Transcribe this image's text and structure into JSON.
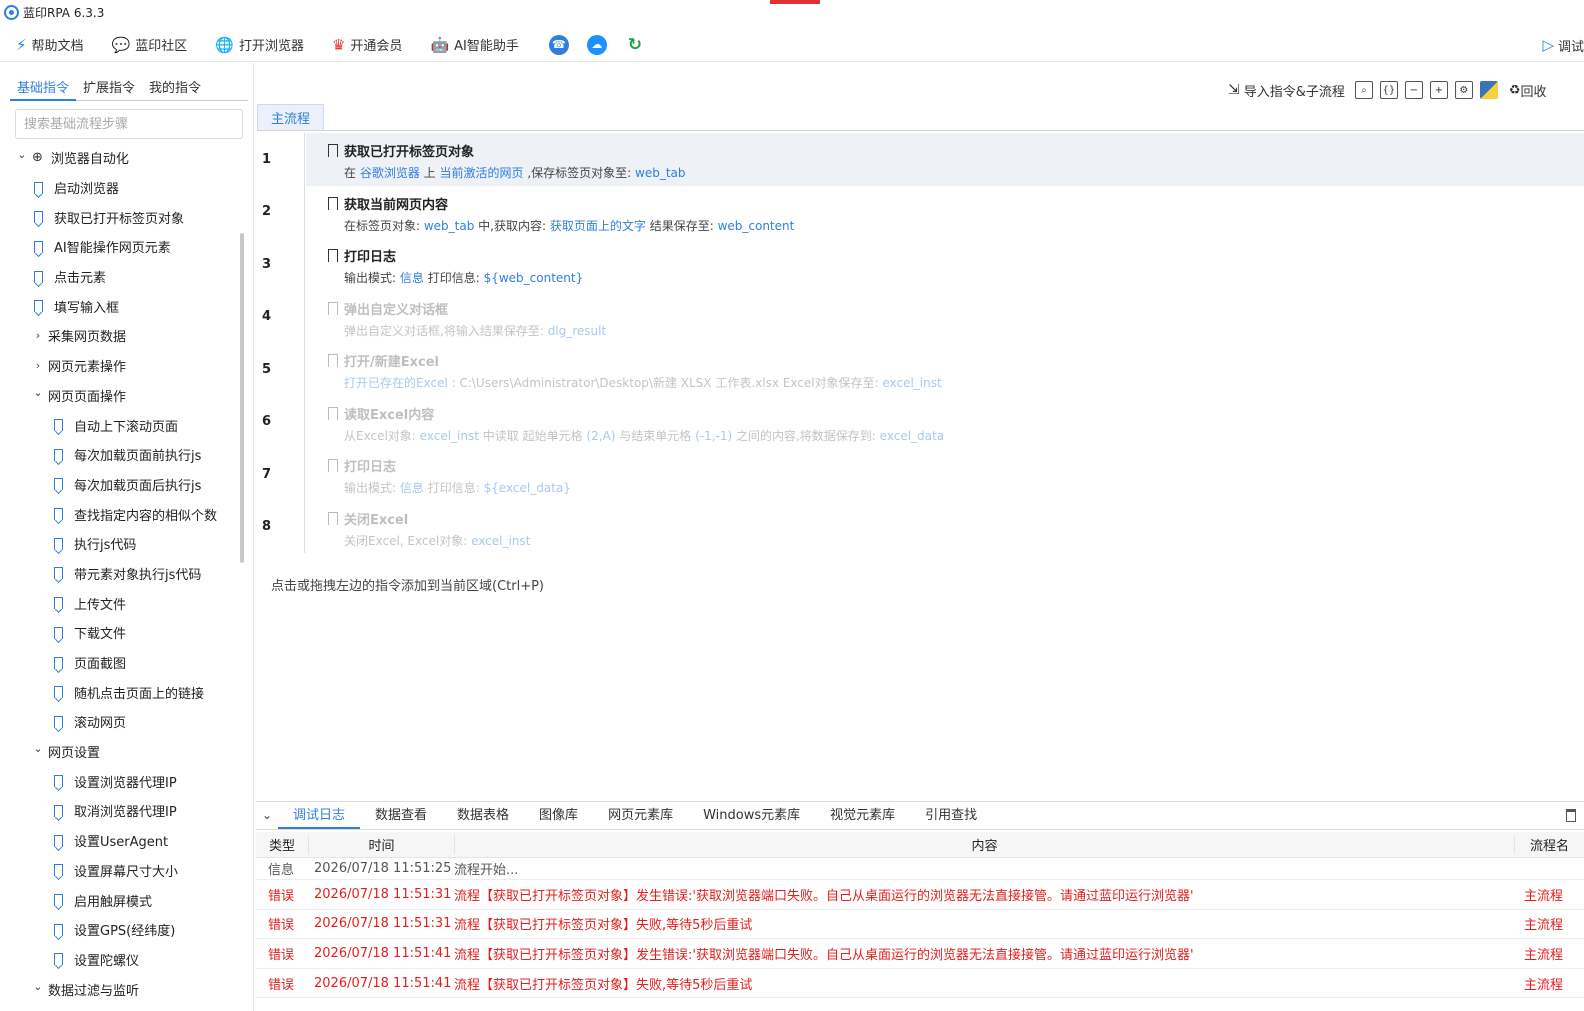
{
  "window": {
    "title": "蓝印RPA 6.3.3"
  },
  "toolbar": {
    "items": [
      {
        "label": "帮助文档",
        "icon": "help-doc-icon"
      },
      {
        "label": "蓝印社区",
        "icon": "community-icon"
      },
      {
        "label": "打开浏览器",
        "icon": "globe-icon"
      },
      {
        "label": "开通会员",
        "icon": "crown-icon"
      },
      {
        "label": "AI智能助手",
        "icon": "robot-icon"
      }
    ],
    "round_icons": [
      "customer-service-icon",
      "cloud-icon",
      "refresh-icon"
    ],
    "debug_label": "调试"
  },
  "left": {
    "tabs": [
      "基础指令",
      "扩展指令",
      "我的指令"
    ],
    "active_tab": "基础指令",
    "search_placeholder": "搜索基础流程步骤",
    "tree": [
      {
        "label": "浏览器自动化",
        "kind": "group",
        "level": 0,
        "expanded": true
      },
      {
        "label": "启动浏览器",
        "kind": "item",
        "level": 1
      },
      {
        "label": "获取已打开标签页对象",
        "kind": "item",
        "level": 1
      },
      {
        "label": "AI智能操作网页元素",
        "kind": "item",
        "level": 1
      },
      {
        "label": "点击元素",
        "kind": "item",
        "level": 1
      },
      {
        "label": "填写输入框",
        "kind": "item",
        "level": 1
      },
      {
        "label": "采集网页数据",
        "kind": "group",
        "level": 1,
        "expanded": false
      },
      {
        "label": "网页元素操作",
        "kind": "group",
        "level": 1,
        "expanded": false
      },
      {
        "label": "网页页面操作",
        "kind": "group",
        "level": 1,
        "expanded": true
      },
      {
        "label": "自动上下滚动页面",
        "kind": "item",
        "level": 2
      },
      {
        "label": "每次加载页面前执行js",
        "kind": "item",
        "level": 2
      },
      {
        "label": "每次加载页面后执行js",
        "kind": "item",
        "level": 2
      },
      {
        "label": "查找指定内容的相似个数",
        "kind": "item",
        "level": 2
      },
      {
        "label": "执行js代码",
        "kind": "item",
        "level": 2
      },
      {
        "label": "带元素对象执行js代码",
        "kind": "item",
        "level": 2
      },
      {
        "label": "上传文件",
        "kind": "item",
        "level": 2
      },
      {
        "label": "下载文件",
        "kind": "item",
        "level": 2
      },
      {
        "label": "页面截图",
        "kind": "item",
        "level": 2
      },
      {
        "label": "随机点击页面上的链接",
        "kind": "item",
        "level": 2
      },
      {
        "label": "滚动网页",
        "kind": "item",
        "level": 2
      },
      {
        "label": "网页设置",
        "kind": "group",
        "level": 1,
        "expanded": true
      },
      {
        "label": "设置浏览器代理IP",
        "kind": "item",
        "level": 2
      },
      {
        "label": "取消浏览器代理IP",
        "kind": "item",
        "level": 2
      },
      {
        "label": "设置UserAgent",
        "kind": "item",
        "level": 2
      },
      {
        "label": "设置屏幕尺寸大小",
        "kind": "item",
        "level": 2
      },
      {
        "label": "启用触屏模式",
        "kind": "item",
        "level": 2
      },
      {
        "label": "设置GPS(经纬度)",
        "kind": "item",
        "level": 2
      },
      {
        "label": "设置陀螺仪",
        "kind": "item",
        "level": 2
      },
      {
        "label": "数据过滤与监听",
        "kind": "group",
        "level": 1,
        "expanded": true
      }
    ]
  },
  "main": {
    "import_label": "导入指令&子流程",
    "recycle_label": "回收",
    "action_icons": [
      "search-icon",
      "braces-icon",
      "collapse-all-icon",
      "expand-all-icon",
      "settings-icon",
      "python-icon"
    ],
    "flow_tab": "主流程",
    "steps": [
      {
        "num": "1",
        "title": "获取已打开标签页对象",
        "selected": true,
        "disabled": false,
        "desc": [
          [
            "在 ",
            false
          ],
          [
            "谷歌浏览器",
            true
          ],
          [
            " 上 ",
            false
          ],
          [
            "当前激活的网页",
            true
          ],
          [
            " ,保存标签页对象至: ",
            false
          ],
          [
            "web_tab",
            true
          ]
        ]
      },
      {
        "num": "2",
        "title": "获取当前网页内容",
        "selected": false,
        "disabled": false,
        "desc": [
          [
            "在标签页对象: ",
            false
          ],
          [
            "web_tab",
            true
          ],
          [
            " 中,获取内容: ",
            false
          ],
          [
            "获取页面上的文字",
            true
          ],
          [
            " 结果保存至: ",
            false
          ],
          [
            "web_content",
            true
          ]
        ]
      },
      {
        "num": "3",
        "title": "打印日志",
        "selected": false,
        "disabled": false,
        "desc": [
          [
            "输出模式: ",
            false
          ],
          [
            "信息",
            true
          ],
          [
            " 打印信息: ",
            false
          ],
          [
            "${web_content}",
            true
          ]
        ]
      },
      {
        "num": "4",
        "title": "弹出自定义对话框",
        "selected": false,
        "disabled": true,
        "desc": [
          [
            "弹出自定义对话框,将输入结果保存至: ",
            false
          ],
          [
            "dlg_result",
            true
          ]
        ]
      },
      {
        "num": "5",
        "title": "打开/新建Excel",
        "selected": false,
        "disabled": true,
        "desc": [
          [
            "打开已存在的Excel : ",
            true
          ],
          [
            "C:\\Users\\Administrator\\Desktop\\新建 XLSX 工作表.xlsx",
            false
          ],
          [
            " Excel对象保存至: ",
            false
          ],
          [
            "excel_inst",
            true
          ]
        ]
      },
      {
        "num": "6",
        "title": "读取Excel内容",
        "selected": false,
        "disabled": true,
        "desc": [
          [
            "从Excel对象: ",
            false
          ],
          [
            "excel_inst",
            true
          ],
          [
            " 中读取 起始单元格 ",
            false
          ],
          [
            "(2,A)",
            true
          ],
          [
            " 与结束单元格 ",
            false
          ],
          [
            "(-1,-1)",
            true
          ],
          [
            " 之间的内容,将数据保存到: ",
            false
          ],
          [
            "excel_data",
            true
          ]
        ]
      },
      {
        "num": "7",
        "title": "打印日志",
        "selected": false,
        "disabled": true,
        "desc": [
          [
            "输出模式: ",
            false
          ],
          [
            "信息",
            true
          ],
          [
            " 打印信息: ",
            false
          ],
          [
            "${excel_data}",
            true
          ]
        ]
      },
      {
        "num": "8",
        "title": "关闭Excel",
        "selected": false,
        "disabled": true,
        "desc": [
          [
            "关闭Excel, Excel对象: ",
            false
          ],
          [
            "excel_inst",
            true
          ]
        ]
      }
    ],
    "hint": "点击或拖拽左边的指令添加到当前区域(Ctrl+P)"
  },
  "bottom": {
    "tabs": [
      "调试日志",
      "数据查看",
      "数据表格",
      "图像库",
      "网页元素库",
      "Windows元素库",
      "视觉元素库",
      "引用查找"
    ],
    "active_tab": "调试日志",
    "columns": {
      "type": "类型",
      "time": "时间",
      "content": "内容",
      "process": "流程名"
    },
    "rows": [
      {
        "type": "信息",
        "time": "2026/07/18 11:51:25",
        "content": "流程开始...",
        "process": "",
        "level": "info"
      },
      {
        "type": "错误",
        "time": "2026/07/18 11:51:31",
        "content": "流程【获取已打开标签页对象】发生错误:'获取浏览器端口失败。自己从桌面运行的浏览器无法直接接管。请通过蓝印运行浏览器'",
        "process": "主流程",
        "level": "err"
      },
      {
        "type": "错误",
        "time": "2026/07/18 11:51:31",
        "content": "流程【获取已打开标签页对象】失败,等待5秒后重试",
        "process": "主流程",
        "level": "err"
      },
      {
        "type": "错误",
        "time": "2026/07/18 11:51:41",
        "content": "流程【获取已打开标签页对象】发生错误:'获取浏览器端口失败。自己从桌面运行的浏览器无法直接接管。请通过蓝印运行浏览器'",
        "process": "主流程",
        "level": "err"
      },
      {
        "type": "错误",
        "time": "2026/07/18 11:51:41",
        "content": "流程【获取已打开标签页对象】失败,等待5秒后重试",
        "process": "主流程",
        "level": "err"
      }
    ]
  },
  "colors": {
    "accent": "#2f7fe0",
    "error": "#e41e1e",
    "selected_row": "#eef1f6"
  }
}
